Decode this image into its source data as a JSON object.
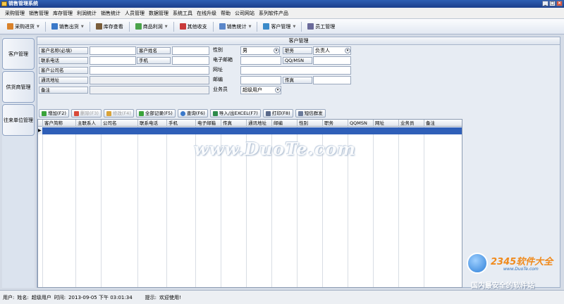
{
  "window": {
    "title": "销售管理系统"
  },
  "menu": [
    "采购管理",
    "销售管理",
    "库存管理",
    "利润统计",
    "销售统计",
    "人员管理",
    "数据管理",
    "系统工具",
    "在线升级",
    "帮助",
    "公司网站",
    "系列软件产品"
  ],
  "toolbar": [
    {
      "label": "采购进货",
      "icon": "purchase-icon",
      "color": "#d9822b"
    },
    {
      "label": "销售出货",
      "icon": "sale-icon",
      "color": "#3a78c9"
    },
    {
      "label": "库存查看",
      "icon": "stock-icon",
      "color": "#7a5d3a"
    },
    {
      "label": "商品利润",
      "icon": "profit-icon",
      "color": "#4aa34a"
    },
    {
      "label": "其他收支",
      "icon": "income-icon",
      "color": "#c93a3a"
    },
    {
      "label": "销售统计",
      "icon": "stats-icon",
      "color": "#5a86c9"
    },
    {
      "label": "客户管理",
      "icon": "customer-icon",
      "color": "#3a8ac9"
    },
    {
      "label": "员工管理",
      "icon": "staff-icon",
      "color": "#6a6a9a"
    }
  ],
  "sidebar": [
    {
      "label": "客户管理"
    },
    {
      "label": "供货商管理"
    },
    {
      "label": "往来单位管理"
    }
  ],
  "panel": {
    "title": "客户管理"
  },
  "form": {
    "customer_name_label": "客户名称(必填)",
    "customer_name": "",
    "customer_surname_label": "客户姓名",
    "customer_surname": "",
    "gender_label": "性别",
    "gender": "男",
    "position_label": "职务",
    "position": "负责人",
    "phone_label": "联系电话",
    "phone": "",
    "mobile_label": "手机",
    "mobile": "",
    "email_label": "电子邮箱",
    "email": "",
    "qq_label": "QQ/MSN",
    "qq": "",
    "company_label": "客户公司名",
    "company": "",
    "website_label": "网址",
    "website": "",
    "address_label": "通讯地址",
    "address": "",
    "zip_label": "邮编",
    "zip": "",
    "fax_label": "传真",
    "fax": "",
    "note_label": "备注",
    "note": "",
    "salesman_label": "业务员",
    "salesman": "超级用户"
  },
  "actions": [
    {
      "label": "增加(F2)",
      "enabled": true,
      "color": "#3aa33a"
    },
    {
      "label": "删除(F3)",
      "enabled": false,
      "color": "#d94a3a"
    },
    {
      "label": "修改(F4)",
      "enabled": false,
      "color": "#d9a33a"
    },
    {
      "label": "全部记录(F5)",
      "enabled": true,
      "color": "#3aa33a"
    },
    {
      "label": "查询(F6)",
      "enabled": true,
      "color": "#3a78c9"
    },
    {
      "label": "导入/出EXCEL(F7)",
      "enabled": true,
      "color": "#2d8a4a"
    },
    {
      "label": "打印(F8)",
      "enabled": true,
      "color": "#5a6a8a"
    },
    {
      "label": "短信群发",
      "enabled": true,
      "color": "#6a7a9a"
    }
  ],
  "table": {
    "columns": [
      "客户简称",
      "主联系人",
      "公司名",
      "联系电话",
      "手机",
      "电子邮箱",
      "传真",
      "通讯地址",
      "邮编",
      "性别",
      "职务",
      "QQMSN",
      "网址",
      "业务员",
      "备注"
    ]
  },
  "watermark": "www.DuoTe.com",
  "corner_logo": {
    "brand": "2345软件大全",
    "site": "www.DuoTe.com",
    "slogan": "国内最安全的软件站"
  },
  "status": {
    "user_label": "用户:",
    "name_label": "姓名:",
    "name": "超级用户",
    "time_label": "时间:",
    "time": "2013-09-05 下午 03:01:34",
    "tip_label": "提示:",
    "tip": "欢迎使用!"
  }
}
